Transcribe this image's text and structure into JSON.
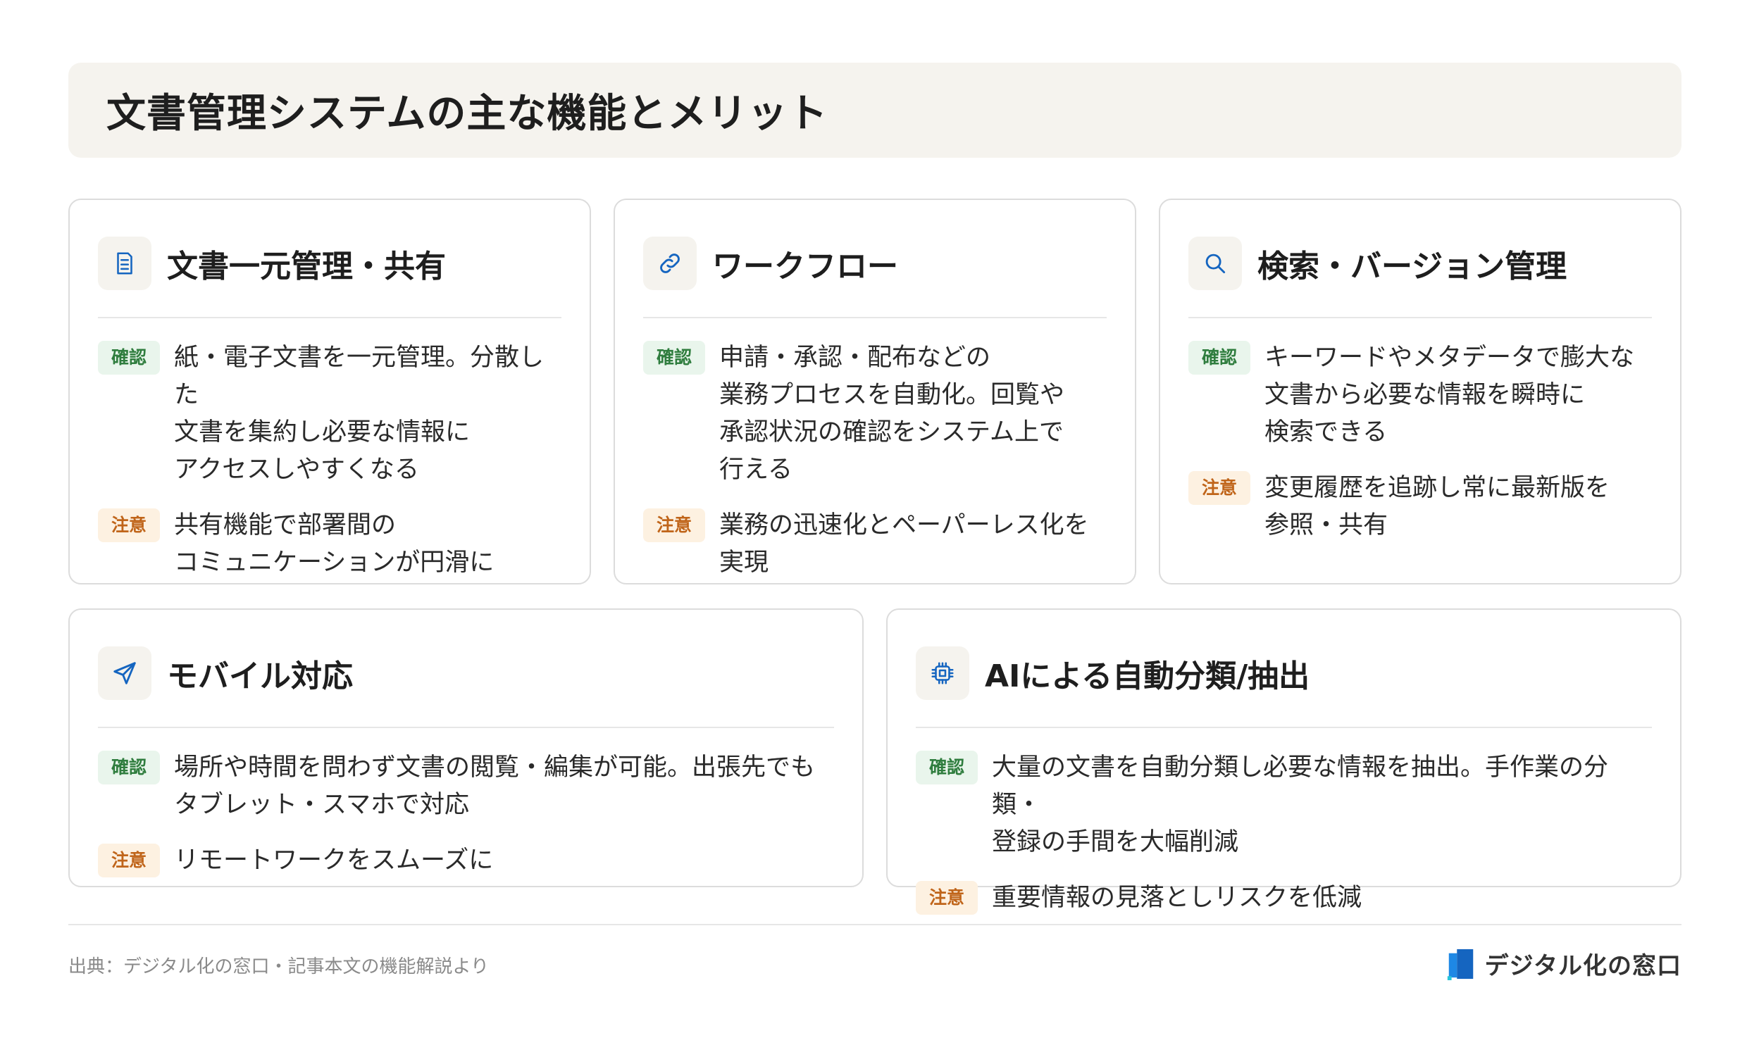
{
  "title": "文書管理システムの主な機能とメリット",
  "badges": {
    "ok": "確認",
    "warn": "注意"
  },
  "cards": [
    {
      "icon": "document-icon",
      "title": "文書一元管理・共有",
      "ok": "紙・電子文書を一元管理。分散した\n文書を集約し必要な情報に\nアクセスしやすくなる",
      "warn": "共有機能で部署間の\nコミュニケーションが円滑に"
    },
    {
      "icon": "link-icon",
      "title": "ワークフロー",
      "ok": "申請・承認・配布などの\n業務プロセスを自動化。回覧や\n承認状況の確認をシステム上で\n行える",
      "warn": "業務の迅速化とペーパーレス化を\n実現"
    },
    {
      "icon": "search-icon",
      "title": "検索・バージョン管理",
      "ok": "キーワードやメタデータで膨大な\n文書から必要な情報を瞬時に\n検索できる",
      "warn": "変更履歴を追跡し常に最新版を\n参照・共有"
    },
    {
      "icon": "send-icon",
      "title": "モバイル対応",
      "ok": "場所や時間を問わず文書の閲覧・編集が可能。出張先でも\nタブレット・スマホで対応",
      "warn": "リモートワークをスムーズに"
    },
    {
      "icon": "chip-icon",
      "title": "AIによる自動分類/抽出",
      "ok": "大量の文書を自動分類し必要な情報を抽出。手作業の分類・\n登録の手間を大幅削減",
      "warn": "重要情報の見落としリスクを低減"
    }
  ],
  "footer": {
    "source": "出典：デジタル化の窓口・記事本文の機能解説より",
    "brand": "デジタル化の窓口"
  },
  "colors": {
    "accent_blue": "#1565c0",
    "ok_green": "#2f7d3e",
    "warn_orange": "#c0651a"
  }
}
